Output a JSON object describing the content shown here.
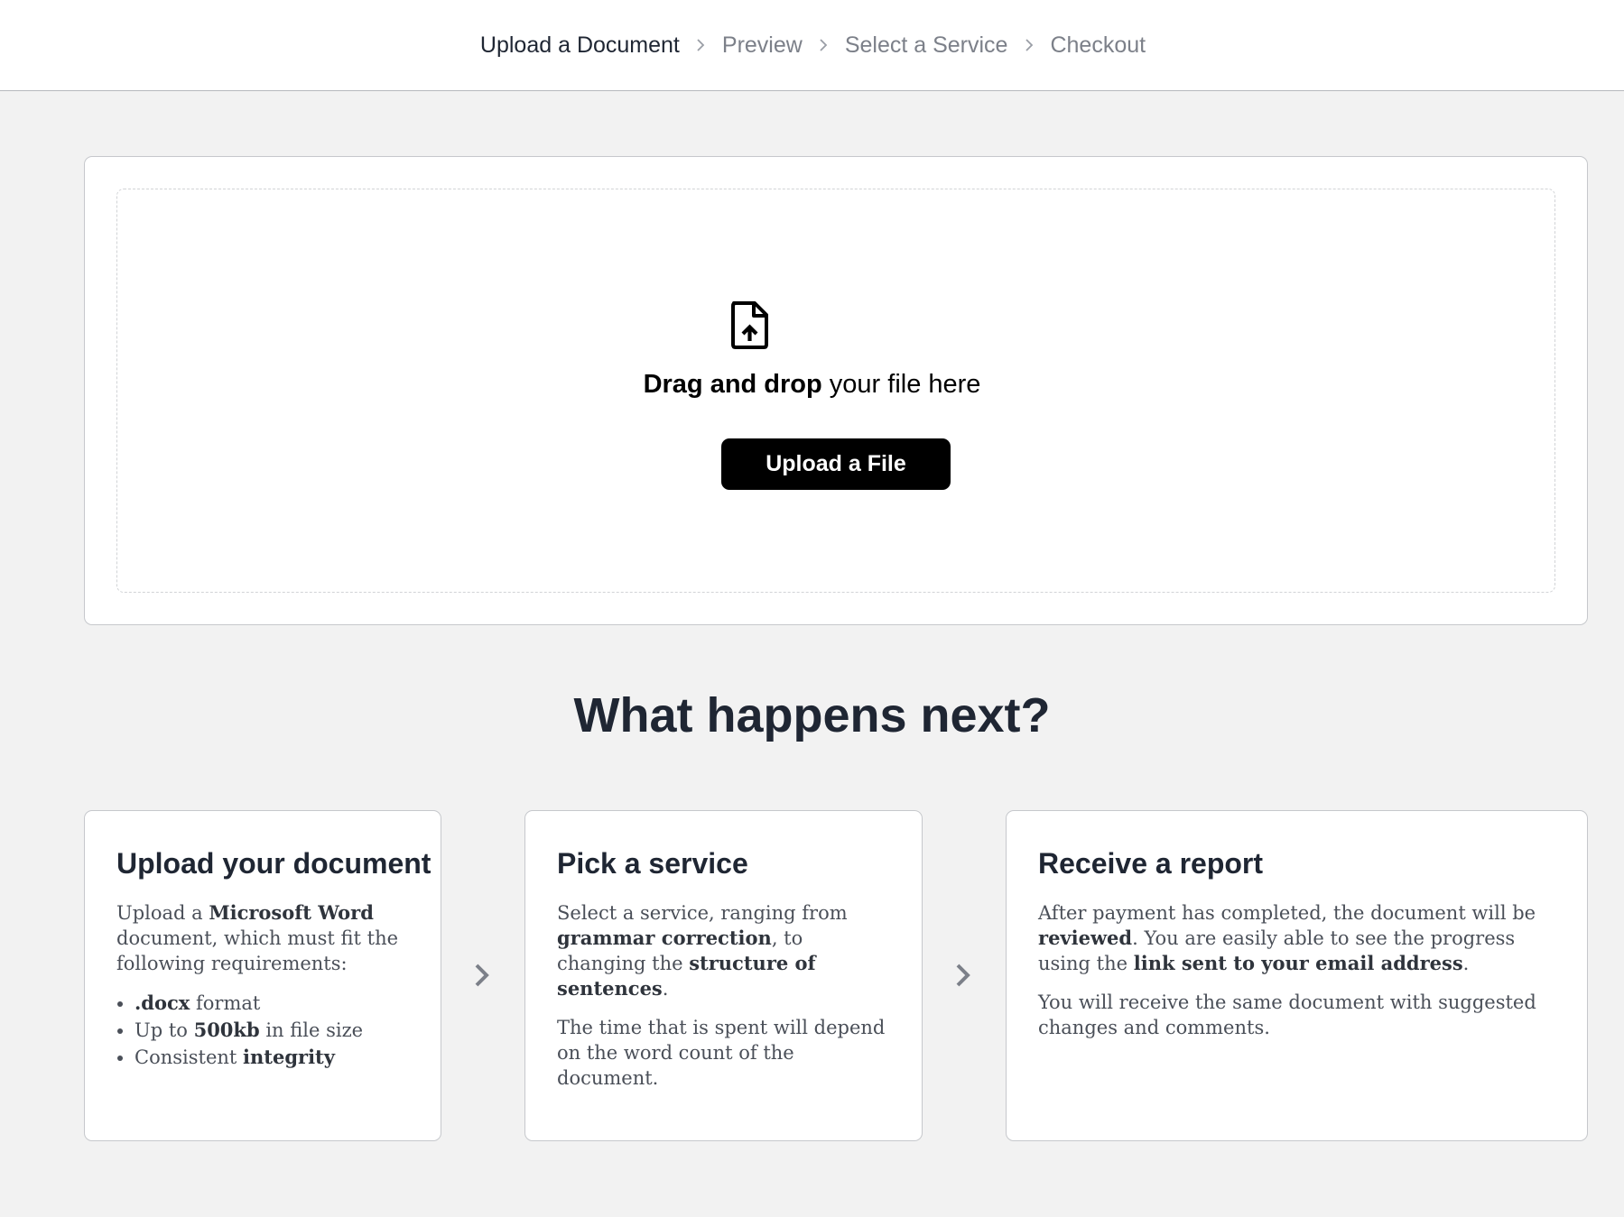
{
  "steps": [
    {
      "label": "Upload a Document",
      "active": true
    },
    {
      "label": "Preview",
      "active": false
    },
    {
      "label": "Select a Service",
      "active": false
    },
    {
      "label": "Checkout",
      "active": false
    }
  ],
  "upload": {
    "icon": "file-upload-icon",
    "drag_bold": "Drag and drop",
    "drag_rest": " your file here",
    "button_label": "Upload a File"
  },
  "next": {
    "title": "What happens next?",
    "cards": [
      {
        "title": "Upload your document",
        "intro_1": "Upload a ",
        "intro_bold": "Microsoft Word",
        "intro_2": " document, which must fit the following requirements:",
        "requirements": [
          {
            "pre": "",
            "bold": ".docx",
            "post": " format"
          },
          {
            "pre": "Up to ",
            "bold": "500kb",
            "post": " in file size"
          },
          {
            "pre": "Consistent ",
            "bold": "integrity",
            "post": ""
          }
        ]
      },
      {
        "title": "Pick a service",
        "p1_a": "Select a service, ranging from ",
        "p1_b": "grammar correction",
        "p1_c": ", to changing the ",
        "p1_d": "structure of sentences",
        "p1_e": ".",
        "p2": "The time that is spent will depend on the word count of the document."
      },
      {
        "title": "Receive a report",
        "p1_a": "After payment has completed, the document will be ",
        "p1_b": "reviewed",
        "p1_c": ". You are easily able to see the progress using the ",
        "p1_d": "link sent to your email address",
        "p1_e": ".",
        "p2": "You will receive the same document with suggested changes and comments."
      }
    ],
    "arrow_icon": "chevron-right-icon"
  },
  "colors": {
    "background": "#f2f2f2",
    "text_dark": "#1f2633",
    "text_muted": "#7c8089",
    "button": "#000000"
  }
}
